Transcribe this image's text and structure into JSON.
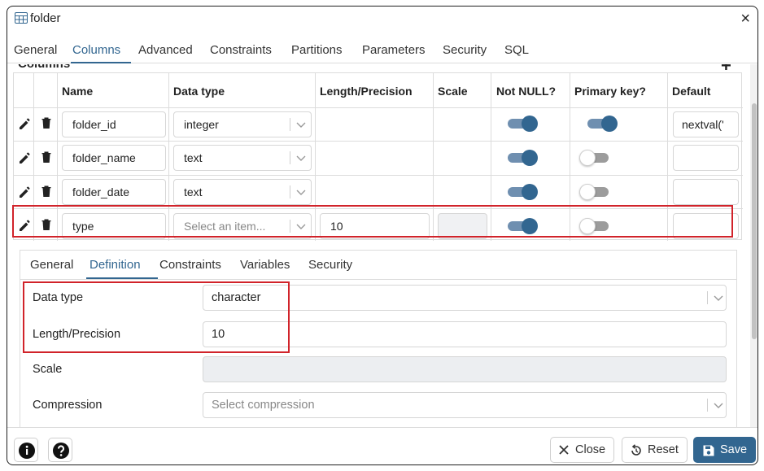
{
  "window": {
    "title": "folder",
    "table_icon": "table-icon",
    "close_glyph": "×"
  },
  "main_tabs": [
    {
      "label": "General"
    },
    {
      "label": "Columns"
    },
    {
      "label": "Advanced"
    },
    {
      "label": "Constraints"
    },
    {
      "label": "Partitions"
    },
    {
      "label": "Parameters"
    },
    {
      "label": "Security"
    },
    {
      "label": "SQL"
    }
  ],
  "active_main_tab": "Columns",
  "columns_section": {
    "label": "Columns",
    "add_glyph": "+"
  },
  "grid": {
    "headers": [
      "Name",
      "Data type",
      "Length/Precision",
      "Scale",
      "Not NULL?",
      "Primary key?",
      "Default"
    ],
    "rows": [
      {
        "name": "folder_id",
        "data_type": "integer",
        "length": "",
        "scale": "",
        "not_null": true,
        "primary_key": true,
        "default": "nextval('"
      },
      {
        "name": "folder_name",
        "data_type": "text",
        "length": "",
        "scale": "",
        "not_null": true,
        "primary_key": false,
        "default": ""
      },
      {
        "name": "folder_date",
        "data_type": "text",
        "length": "",
        "scale": "",
        "not_null": true,
        "primary_key": false,
        "default": ""
      },
      {
        "name": "type",
        "data_type_placeholder": "Select an item...",
        "length": "10",
        "scale": "",
        "not_null": true,
        "primary_key": false,
        "default": ""
      }
    ]
  },
  "detail": {
    "tabs": [
      {
        "label": "General"
      },
      {
        "label": "Definition"
      },
      {
        "label": "Constraints"
      },
      {
        "label": "Variables"
      },
      {
        "label": "Security"
      }
    ],
    "active_tab": "Definition",
    "fields": {
      "data_type": {
        "label": "Data type",
        "value": "character"
      },
      "length": {
        "label": "Length/Precision",
        "value": "10"
      },
      "scale": {
        "label": "Scale",
        "value": ""
      },
      "compression": {
        "label": "Compression",
        "placeholder": "Select compression"
      }
    }
  },
  "footer": {
    "info_icon": "info-icon",
    "help_icon": "help-icon",
    "close_label": "Close",
    "reset_label": "Reset",
    "save_label": "Save"
  },
  "colors": {
    "accent": "#326690",
    "highlight": "#d1232a",
    "toggle_on": "#326690",
    "toggle_off": "#9c9c9c"
  }
}
